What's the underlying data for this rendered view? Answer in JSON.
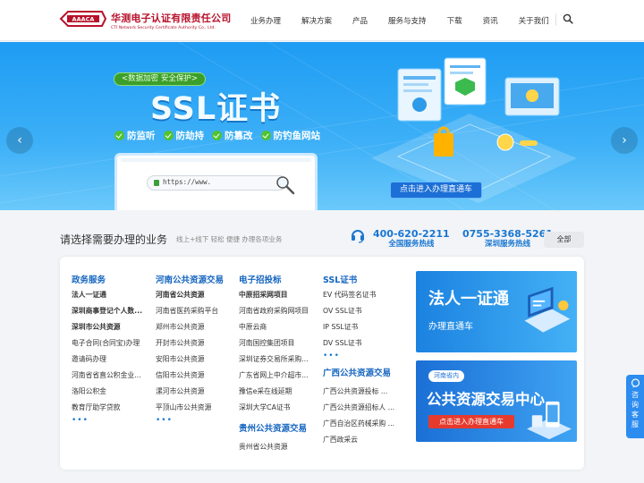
{
  "brand": {
    "name_cn": "华测电子认证有限责任公司",
    "name_en": "CTI Network Security Certificate Authority Co., Ltd.",
    "logo_text": "AAACA",
    "logo_color": "#b8122b"
  },
  "nav": {
    "items": [
      "业务办理",
      "解决方案",
      "产品",
      "服务与支持",
      "下载",
      "资讯",
      "关于我们"
    ],
    "search_icon": "search-icon"
  },
  "banner": {
    "pill": "<数据加密 安全保护>",
    "title": "SSL证书",
    "features": [
      "防监听",
      "防劫持",
      "防篡改",
      "防钓鱼网站"
    ],
    "url": "https://www.",
    "cta": "点击进入办理直通车",
    "prev_icon": "chevron-left-icon",
    "next_icon": "chevron-right-icon"
  },
  "business": {
    "title": "请选择需要办理的业务",
    "subtitle": "线上+线下 轻松 便捷 办理各项业务",
    "hotline1": {
      "number": "400-620-2211",
      "label": "全国服务热线"
    },
    "hotline2": {
      "number": "0755-3368-5261",
      "label": "深圳服务热线"
    },
    "all_label": "全部"
  },
  "columns": {
    "gov": {
      "title": "政务服务",
      "items": [
        "法人一证通",
        "深圳商事登记个人数...",
        "深圳市公共资源",
        "电子合同(合同宝)办理",
        "邀请码办理",
        "河南省省直公积金业...",
        "洛阳公积金",
        "教育厅助学贷款"
      ],
      "more": "•••"
    },
    "henan": {
      "title": "河南公共资源交易",
      "items": [
        "河南省公共资源",
        "河南省医药采购平台",
        "郑州市公共资源",
        "开封市公共资源",
        "安阳市公共资源",
        "信阳市公共资源",
        "漯河市公共资源",
        "平顶山市公共资源"
      ],
      "more": "•••"
    },
    "bidding": {
      "title": "电子招投标",
      "items": [
        "中原招采网项目",
        "河南省政府采购网项目",
        "中原云商",
        "河南国控集团项目",
        "深圳证券交易所采购...",
        "广东省网上中介超市...",
        "豫信e采在线延期",
        "深圳大学CA证书"
      ],
      "guizhou_title": "贵州公共资源交易",
      "guizhou_items": [
        "贵州省公共资源"
      ]
    },
    "ssl": {
      "title": "SSL证书",
      "items": [
        "EV 代码签名证书",
        "OV SSL证书",
        "IP SSL证书",
        "DV SSL证书"
      ],
      "more": "•••",
      "guangxi_title": "广西公共资源交易",
      "guangxi_items": [
        "广西公共资源投标 ...",
        "广西公共资源招标人 ...",
        "广西自治区药械采购 ...",
        "广西政采云"
      ]
    }
  },
  "promos": {
    "p1": {
      "title": "法人一证通",
      "subtitle": "办理直通车"
    },
    "p2": {
      "tag": "河南省内",
      "title": "公共资源交易中心",
      "button": "点击进入办理直通车"
    }
  },
  "float_tab": {
    "label": "咨询客服"
  }
}
